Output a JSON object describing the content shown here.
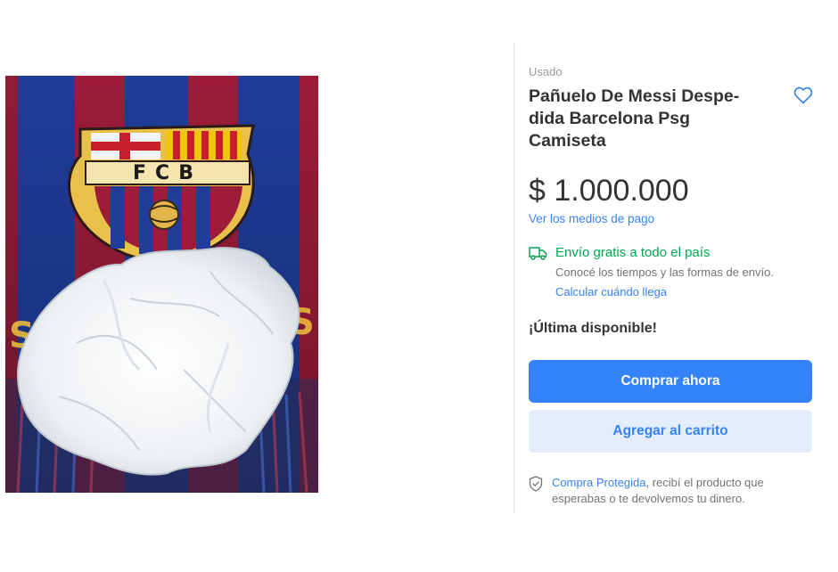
{
  "product": {
    "condition": "Usado",
    "title": "Pañuelo De Messi Despe-dida Barcelona Psg Camiseta",
    "title_line1": "Pañuelo De Messi Despe-",
    "title_line2": "dida Barcelona Psg",
    "title_line3": "Camiseta",
    "price": "$ 1.000.000",
    "payment_link": "Ver los medios de pago",
    "image_alt": "Pañuelo usado sobre bufanda del FC Barcelona"
  },
  "shipping": {
    "title": "Envío gratis a todo el país",
    "description": "Conocé los tiempos y las formas de envío.",
    "link": "Calcular cuándo llega",
    "icon": "truck-icon"
  },
  "stock": {
    "label": "¡Última disponible!"
  },
  "actions": {
    "buy_label": "Comprar ahora",
    "cart_label": "Agregar al carrito",
    "favorite_icon": "heart-icon"
  },
  "protection": {
    "link": "Compra Protegida",
    "text": ", recibí el producto que esperabas o te devolvemos tu dinero.",
    "icon": "shield-check-icon"
  },
  "crest": {
    "letters": "FCB"
  },
  "colors": {
    "accent": "#3483fa",
    "accent_light": "#e3edfb",
    "shipping_green": "#00a650",
    "club_blue": "#1f3d99",
    "club_red": "#9c1c3a"
  }
}
